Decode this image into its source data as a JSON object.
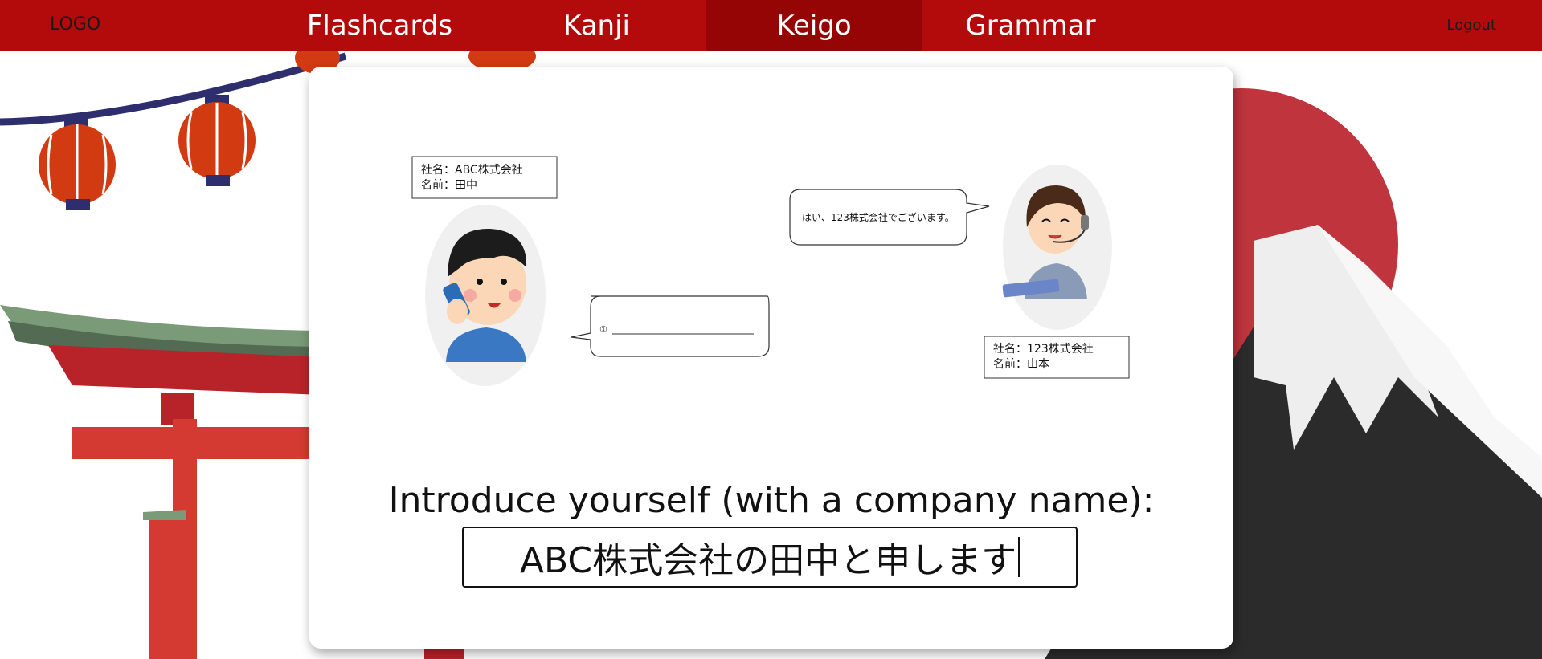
{
  "nav": {
    "logo": "LOGO",
    "tabs": [
      {
        "label": "Flashcards"
      },
      {
        "label": "Kanji"
      },
      {
        "label": "Keigo",
        "active": true
      },
      {
        "label": "Grammar"
      }
    ],
    "logout": "Logout"
  },
  "scene": {
    "caller_info": [
      "社名：ABC株式会社",
      "名前：田中"
    ],
    "receiver_info": [
      "社名：123株式会社",
      "名前：山本"
    ],
    "receiver_speech": "はい、123株式会社でございます。",
    "caller_speech_marker": "①"
  },
  "exercise": {
    "prompt": "Introduce yourself (with a company name):",
    "answer": "ABC株式会社の田中と申します"
  },
  "colors": {
    "nav_red": "#b30b0b",
    "nav_active": "#960505",
    "sun_red": "#c0343d",
    "mountain_dark": "#2b2b2b"
  },
  "icons": [
    "lantern-icon",
    "torii-gate-icon",
    "mount-fuji-icon",
    "caller-avatar-icon",
    "receptionist-avatar-icon"
  ]
}
